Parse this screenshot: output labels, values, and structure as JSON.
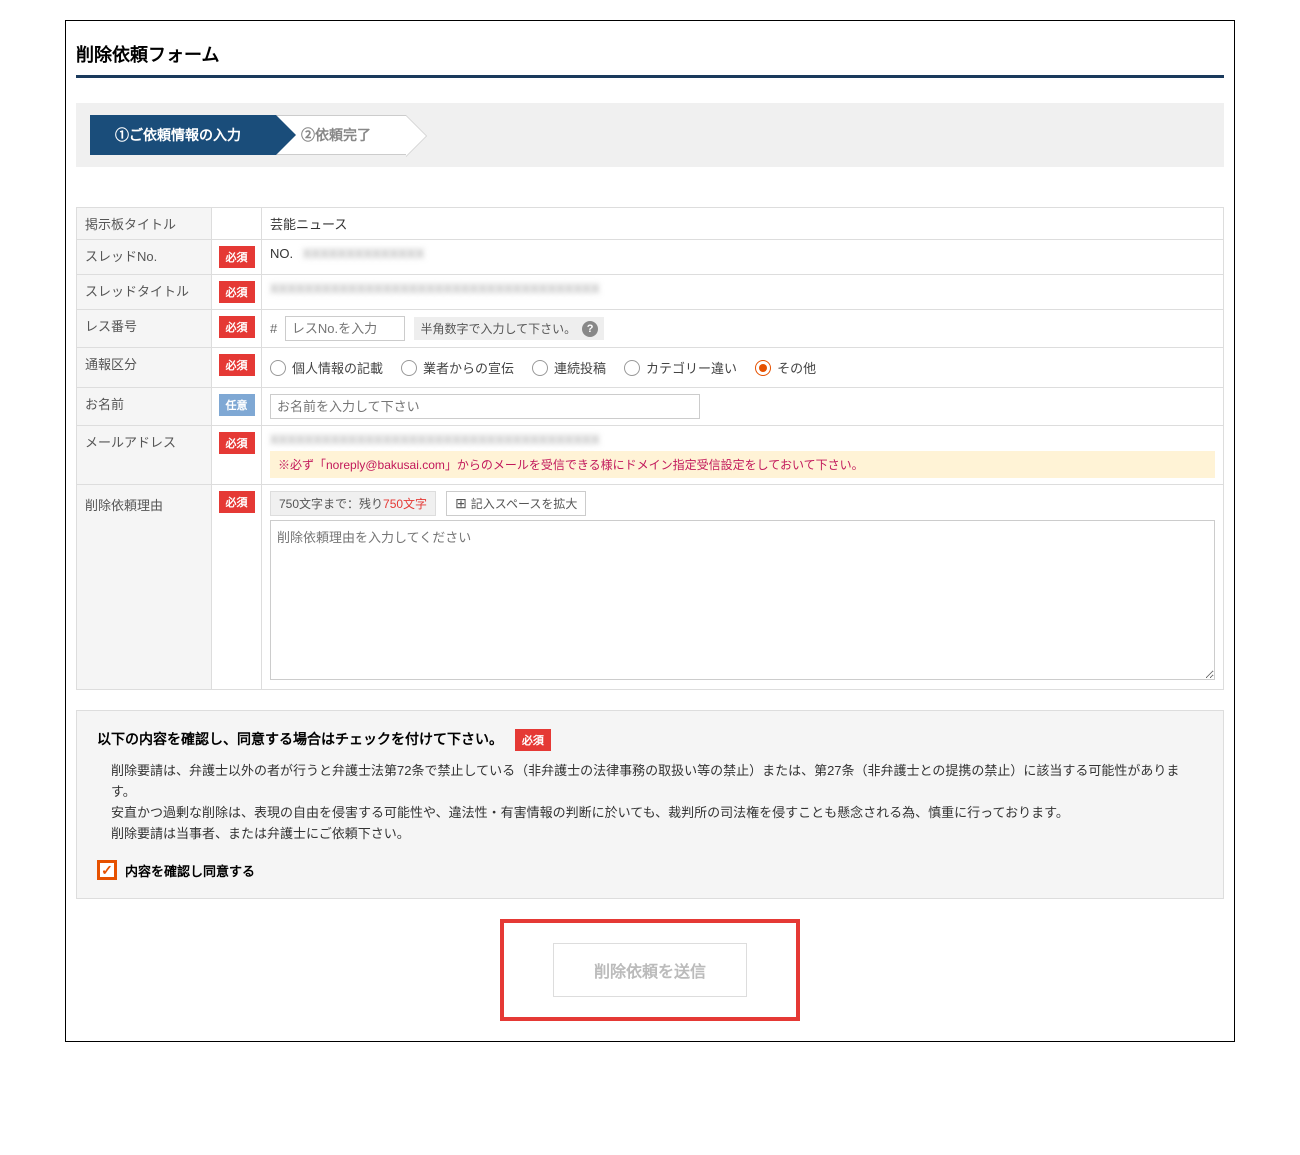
{
  "form_title": "削除依頼フォーム",
  "steps": {
    "step1": "①ご依頼情報の入力",
    "step2": "②依頼完了"
  },
  "badges": {
    "required": "必須",
    "optional": "任意"
  },
  "fields": {
    "board_title": {
      "label": "掲示板タイトル",
      "value": "芸能ニュース"
    },
    "thread_no": {
      "label": "スレッドNo.",
      "prefix": "NO.",
      "value_obscured": "XXXXXXXXXXXXXX"
    },
    "thread_title": {
      "label": "スレッドタイトル",
      "value_obscured": "XXXXXXXXXXXXXXXXXXXXXXXXXXXXXXXXXXXXXX"
    },
    "res_no": {
      "label": "レス番号",
      "prefix": "#",
      "placeholder": "レスNo.を入力",
      "hint": "半角数字で入力して下さい。"
    },
    "report_type": {
      "label": "通報区分",
      "options": [
        "個人情報の記載",
        "業者からの宣伝",
        "連続投稿",
        "カテゴリー違い",
        "その他"
      ],
      "selected_index": 4
    },
    "name": {
      "label": "お名前",
      "placeholder": "お名前を入力して下さい"
    },
    "email": {
      "label": "メールアドレス",
      "value_obscured": "XXXXXXXXXXXXXXXXXXXXXXXXXXXXXXXXXXXXXX",
      "note": "※必ず「noreply@bakusai.com」からのメールを受信できる様にドメイン指定受信設定をしておいて下さい。"
    },
    "reason": {
      "label": "削除依頼理由",
      "char_info_prefix": "750文字まで：残り",
      "char_count": "750文字",
      "expand_label": "記入スペースを拡大",
      "placeholder": "削除依頼理由を入力してください"
    }
  },
  "agreement": {
    "heading": "以下の内容を確認し、同意する場合はチェックを付けて下さい。",
    "body": "削除要請は、弁護士以外の者が行うと弁護士法第72条で禁止している（非弁護士の法律事務の取扱い等の禁止）または、第27条（非弁護士との提携の禁止）に該当する可能性があります。\n安直かつ過剰な削除は、表現の自由を侵害する可能性や、違法性・有害情報の判断に於いても、裁判所の司法権を侵すことも懸念される為、慎重に行っております。\n削除要請は当事者、または弁護士にご依頼下さい。",
    "checkbox_label": "内容を確認し同意する",
    "checked": true
  },
  "submit_label": "削除依頼を送信"
}
